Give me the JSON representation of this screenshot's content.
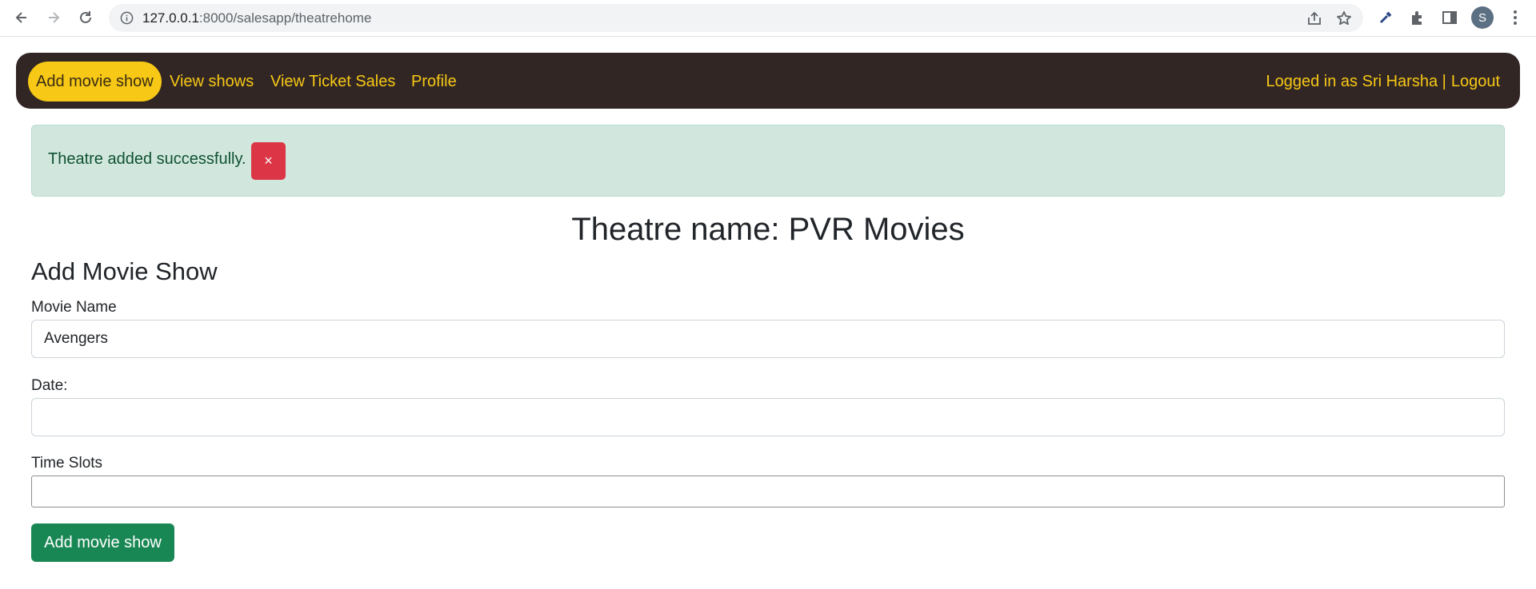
{
  "browser": {
    "url_host": "127.0.0.1",
    "url_rest": ":8000/salesapp/theatrehome",
    "profile_initial": "S"
  },
  "navbar": {
    "links": [
      {
        "label": "Add movie show",
        "active": true
      },
      {
        "label": "View shows",
        "active": false
      },
      {
        "label": "View Ticket Sales",
        "active": false
      },
      {
        "label": "Profile",
        "active": false
      }
    ],
    "logged_in_text": "Logged in as Sri Harsha |",
    "logout_label": "Logout"
  },
  "alert": {
    "message": "Theatre added successfully.",
    "close_label": "×"
  },
  "page": {
    "theatre_title": "Theatre name: PVR Movies",
    "form_title": "Add Movie Show"
  },
  "form": {
    "movie_name_label": "Movie Name",
    "movie_name_value": "Avengers",
    "date_label": "Date:",
    "date_value": "",
    "time_slots_label": "Time Slots",
    "time_slots_value": "",
    "submit_label": "Add movie show"
  },
  "colors": {
    "navbar_bg": "#312624",
    "nav_accent": "#f7c816",
    "alert_bg": "#d1e7dd",
    "close_button": "#dc3545",
    "submit_button": "#198754"
  },
  "icons": [
    "back-arrow-icon",
    "forward-arrow-icon",
    "reload-icon",
    "info-icon",
    "share-icon",
    "star-icon",
    "eyedropper-icon",
    "extension-icon",
    "sidepanel-icon",
    "menu-dots-icon"
  ]
}
